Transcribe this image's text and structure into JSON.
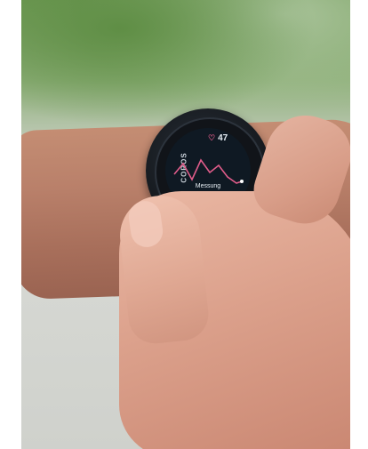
{
  "watch": {
    "brand": "COROS",
    "heart_rate": "47",
    "heart_icon": "heart-icon",
    "label": "Messung",
    "progress": 0.4,
    "graph": [
      [
        10,
        52
      ],
      [
        20,
        40
      ],
      [
        30,
        58
      ],
      [
        40,
        36
      ],
      [
        50,
        50
      ],
      [
        60,
        42
      ],
      [
        70,
        55
      ],
      [
        80,
        62
      ],
      [
        86,
        60
      ]
    ]
  },
  "colors": {
    "screen_bg": "#0f1923",
    "graph_line": "#e05c8a",
    "heart": "#e05c8a"
  }
}
